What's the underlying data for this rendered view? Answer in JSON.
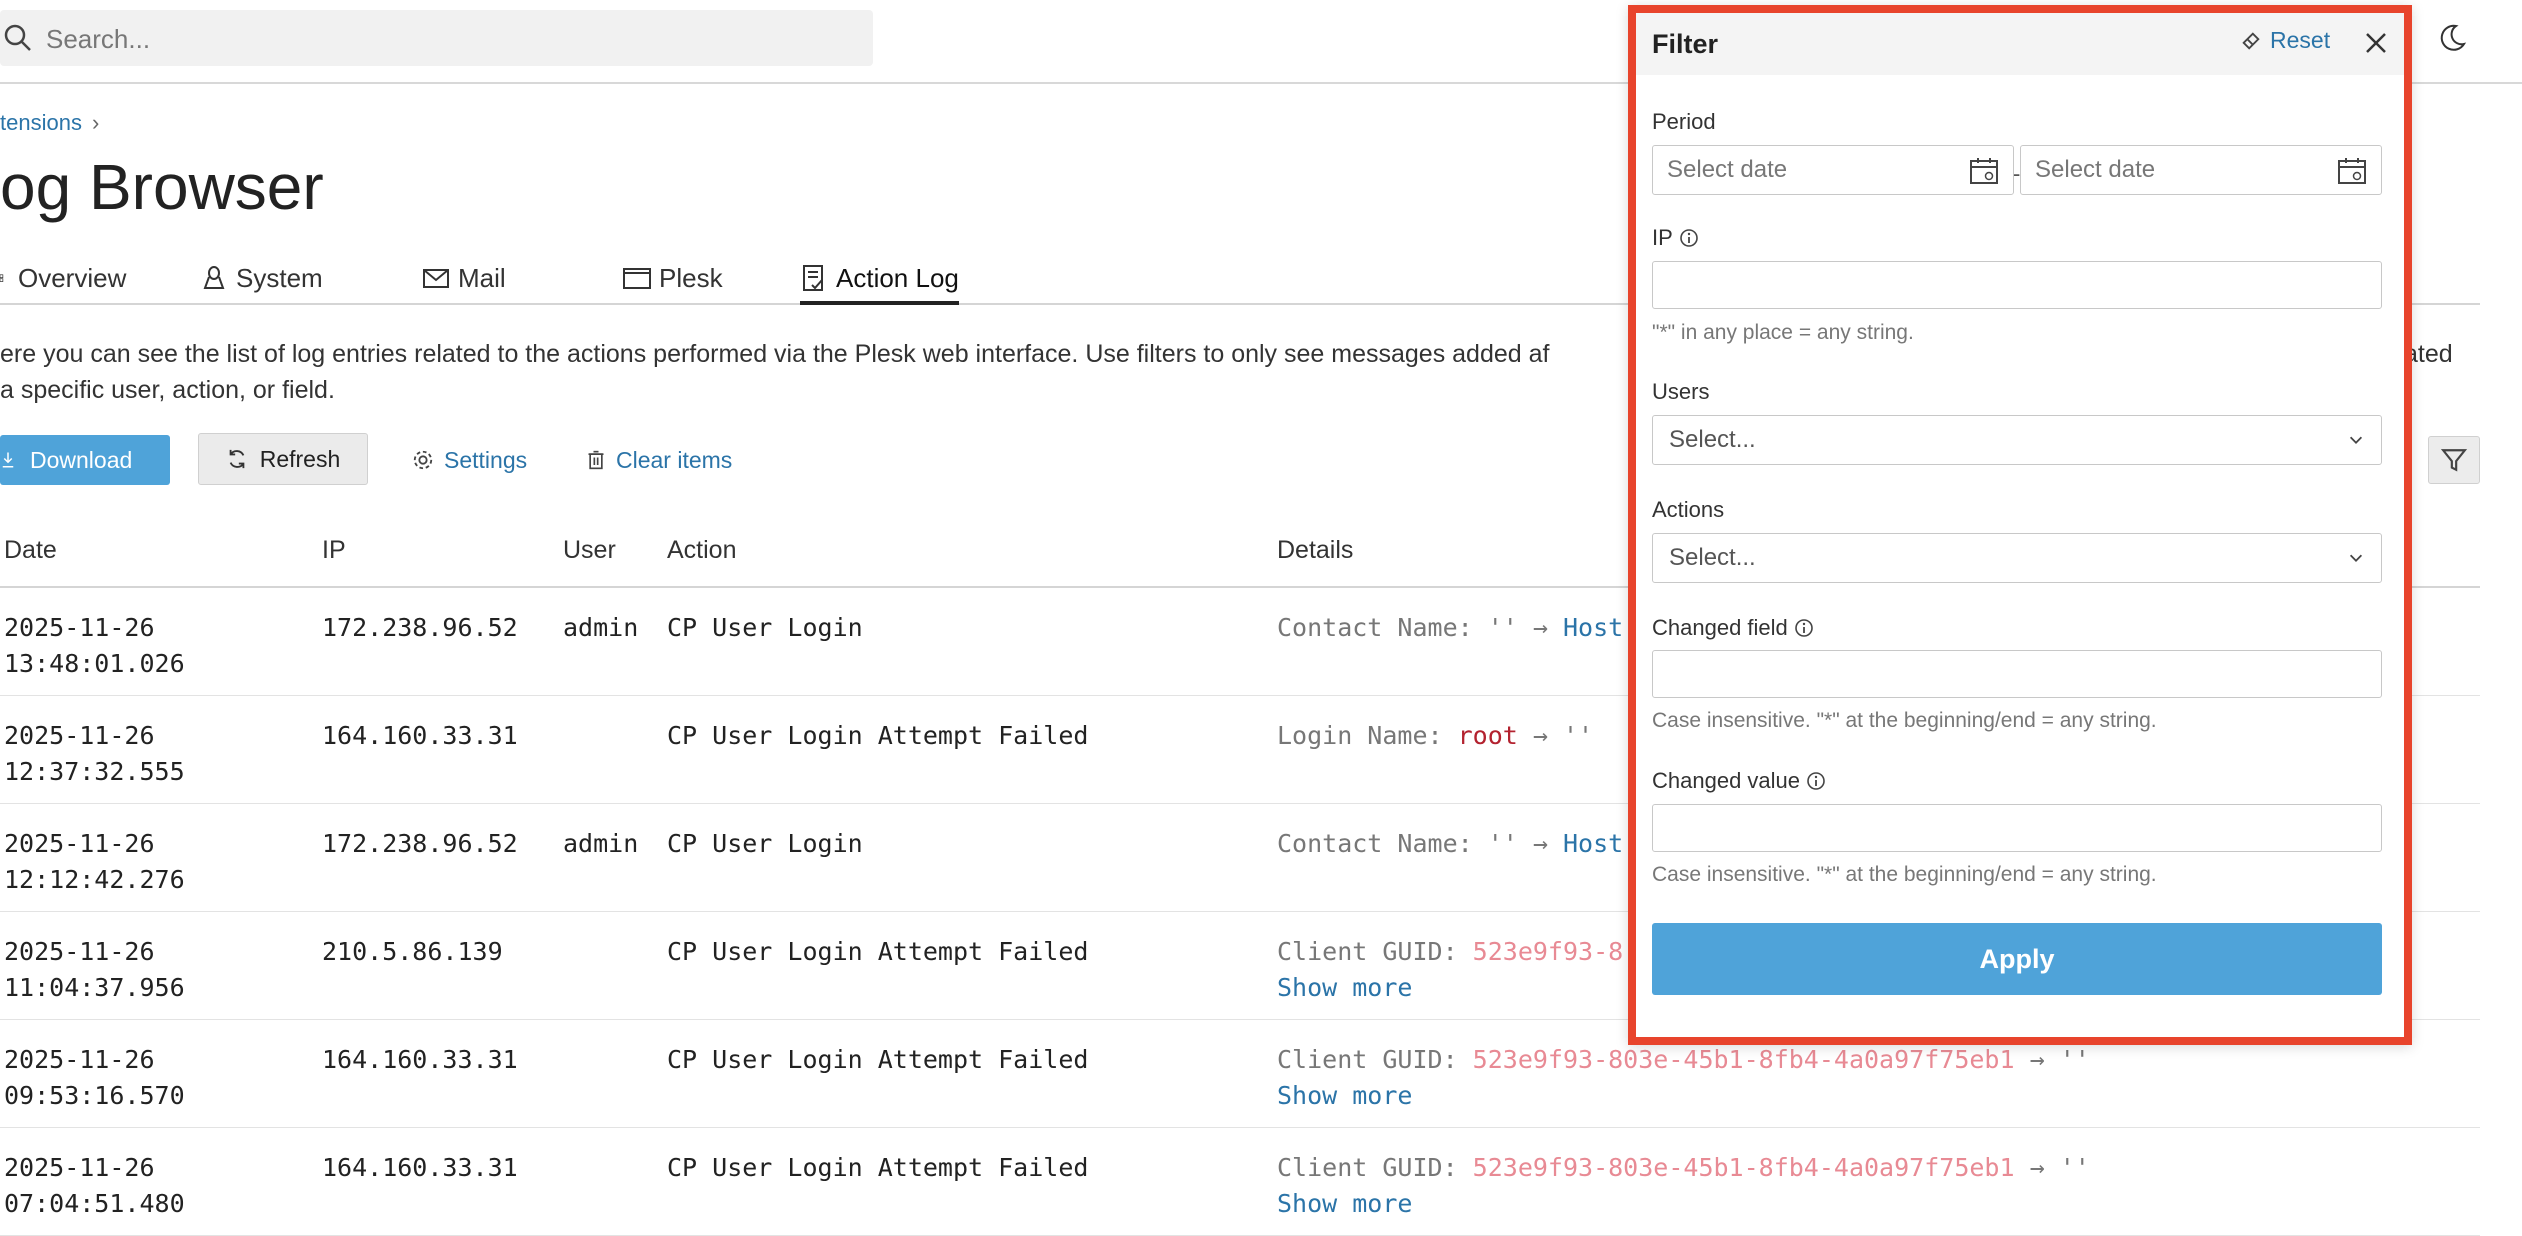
{
  "search": {
    "placeholder": "Search..."
  },
  "breadcrumb": {
    "item": "tensions",
    "separator": "›"
  },
  "page": {
    "title": "og Browser"
  },
  "tabs": [
    {
      "label": "Overview",
      "icon": "overview-icon"
    },
    {
      "label": "System",
      "icon": "linux-icon"
    },
    {
      "label": "Mail",
      "icon": "envelope-icon"
    },
    {
      "label": "Plesk",
      "icon": "window-icon"
    },
    {
      "label": "Action Log",
      "icon": "action-log-icon",
      "active": true
    }
  ],
  "description": {
    "line1": "ere you can see the list of log entries related to the actions performed via the Plesk web interface. Use filters to only see messages added af",
    "line1_tail": "ated",
    "line2": " a specific user, action, or field."
  },
  "toolbar": {
    "download": "Download",
    "refresh": "Refresh",
    "settings": "Settings",
    "clear": "Clear items"
  },
  "table": {
    "columns": [
      "Date",
      "IP",
      "User",
      "Action",
      "Details"
    ],
    "rows": [
      {
        "date1": "2025-11-26",
        "date2": "13:48:01.026",
        "ip": "172.238.96.52",
        "user": "admin",
        "action": "CP User Login",
        "details_key": "Contact Name: ",
        "details_old": "''",
        "details_arrow": " → ",
        "details_new": "Host",
        "show_more": ""
      },
      {
        "date1": "2025-11-26",
        "date2": "12:37:32.555",
        "ip": "164.160.33.31",
        "user": "",
        "action": "CP User Login Attempt Failed",
        "details_key": "Login Name: ",
        "details_old": "root",
        "details_arrow": " → ",
        "details_new": "''",
        "show_more": ""
      },
      {
        "date1": "2025-11-26",
        "date2": "12:12:42.276",
        "ip": "172.238.96.52",
        "user": "admin",
        "action": "CP User Login",
        "details_key": "Contact Name: ",
        "details_old": "''",
        "details_arrow": " → ",
        "details_new": "Host",
        "show_more": ""
      },
      {
        "date1": "2025-11-26",
        "date2": "11:04:37.956",
        "ip": "210.5.86.139",
        "user": "",
        "action": "CP User Login Attempt Failed",
        "details_key": "Client GUID: ",
        "details_old": "523e9f93-8",
        "details_arrow": "",
        "details_new": "",
        "show_more": "Show more"
      },
      {
        "date1": "2025-11-26",
        "date2": "09:53:16.570",
        "ip": "164.160.33.31",
        "user": "",
        "action": "CP User Login Attempt Failed",
        "details_key": "Client GUID: ",
        "details_old": "523e9f93-803e-45b1-8fb4-4a0a97f75eb1",
        "details_arrow": " → ",
        "details_new": "''",
        "show_more": "Show more"
      },
      {
        "date1": "2025-11-26",
        "date2": "07:04:51.480",
        "ip": "164.160.33.31",
        "user": "",
        "action": "CP User Login Attempt Failed",
        "details_key": "Client GUID: ",
        "details_old": "523e9f93-803e-45b1-8fb4-4a0a97f75eb1",
        "details_arrow": " → ",
        "details_new": "''",
        "show_more": "Show more"
      }
    ]
  },
  "filter": {
    "title": "Filter",
    "reset": "Reset",
    "period_label": "Period",
    "date_from_placeholder": "Select date",
    "date_to_placeholder": "Select date",
    "date_separator": "-",
    "ip_label": "IP",
    "ip_hint": "\"*\" in any place = any string.",
    "users_label": "Users",
    "users_placeholder": "Select...",
    "actions_label": "Actions",
    "actions_placeholder": "Select...",
    "changed_field_label": "Changed field",
    "changed_field_hint": "Case insensitive. \"*\" at the beginning/end = any string.",
    "changed_value_label": "Changed value",
    "changed_value_hint": "Case insensitive. \"*\" at the beginning/end = any string.",
    "apply": "Apply"
  },
  "colors": {
    "accent": "#4fa3d9",
    "link": "#2b74a8",
    "highlight_border": "#e8442c",
    "old_value_red": "#b3222f",
    "guid_pink": "#e88a94"
  }
}
